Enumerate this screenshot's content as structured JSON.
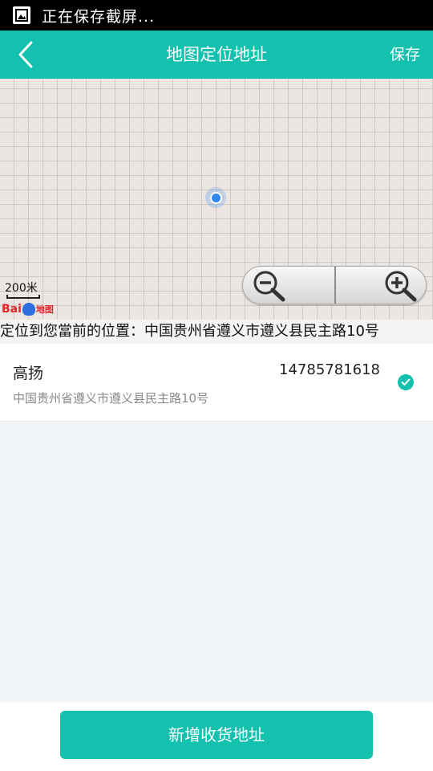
{
  "status_bar": {
    "text": "正在保存截屏...",
    "icon": "image-icon"
  },
  "header": {
    "back_icon": "chevron-left-icon",
    "title": "地图定位地址",
    "save_label": "保存"
  },
  "map": {
    "scale_label": "200米",
    "logo_text_bai": "Bai",
    "logo_text_ditu": "地图",
    "zoom_out_icon": "zoom-out-icon",
    "zoom_in_icon": "zoom-in-icon",
    "location_marker_icon": "location-dot-icon"
  },
  "current_location": "定位到您當前的位置：中国贵州省遵义市遵义县民主路10号",
  "address": {
    "name": "高扬",
    "phone": "14785781618",
    "detail": "中国贵州省遵义市遵义县民主路10号",
    "selected": true,
    "check_icon": "check-circle-icon"
  },
  "footer": {
    "add_button_label": "新增收货地址"
  },
  "colors": {
    "accent": "#14c0ae",
    "background": "#f3f6f9",
    "location_dot": "#2f87ee"
  }
}
